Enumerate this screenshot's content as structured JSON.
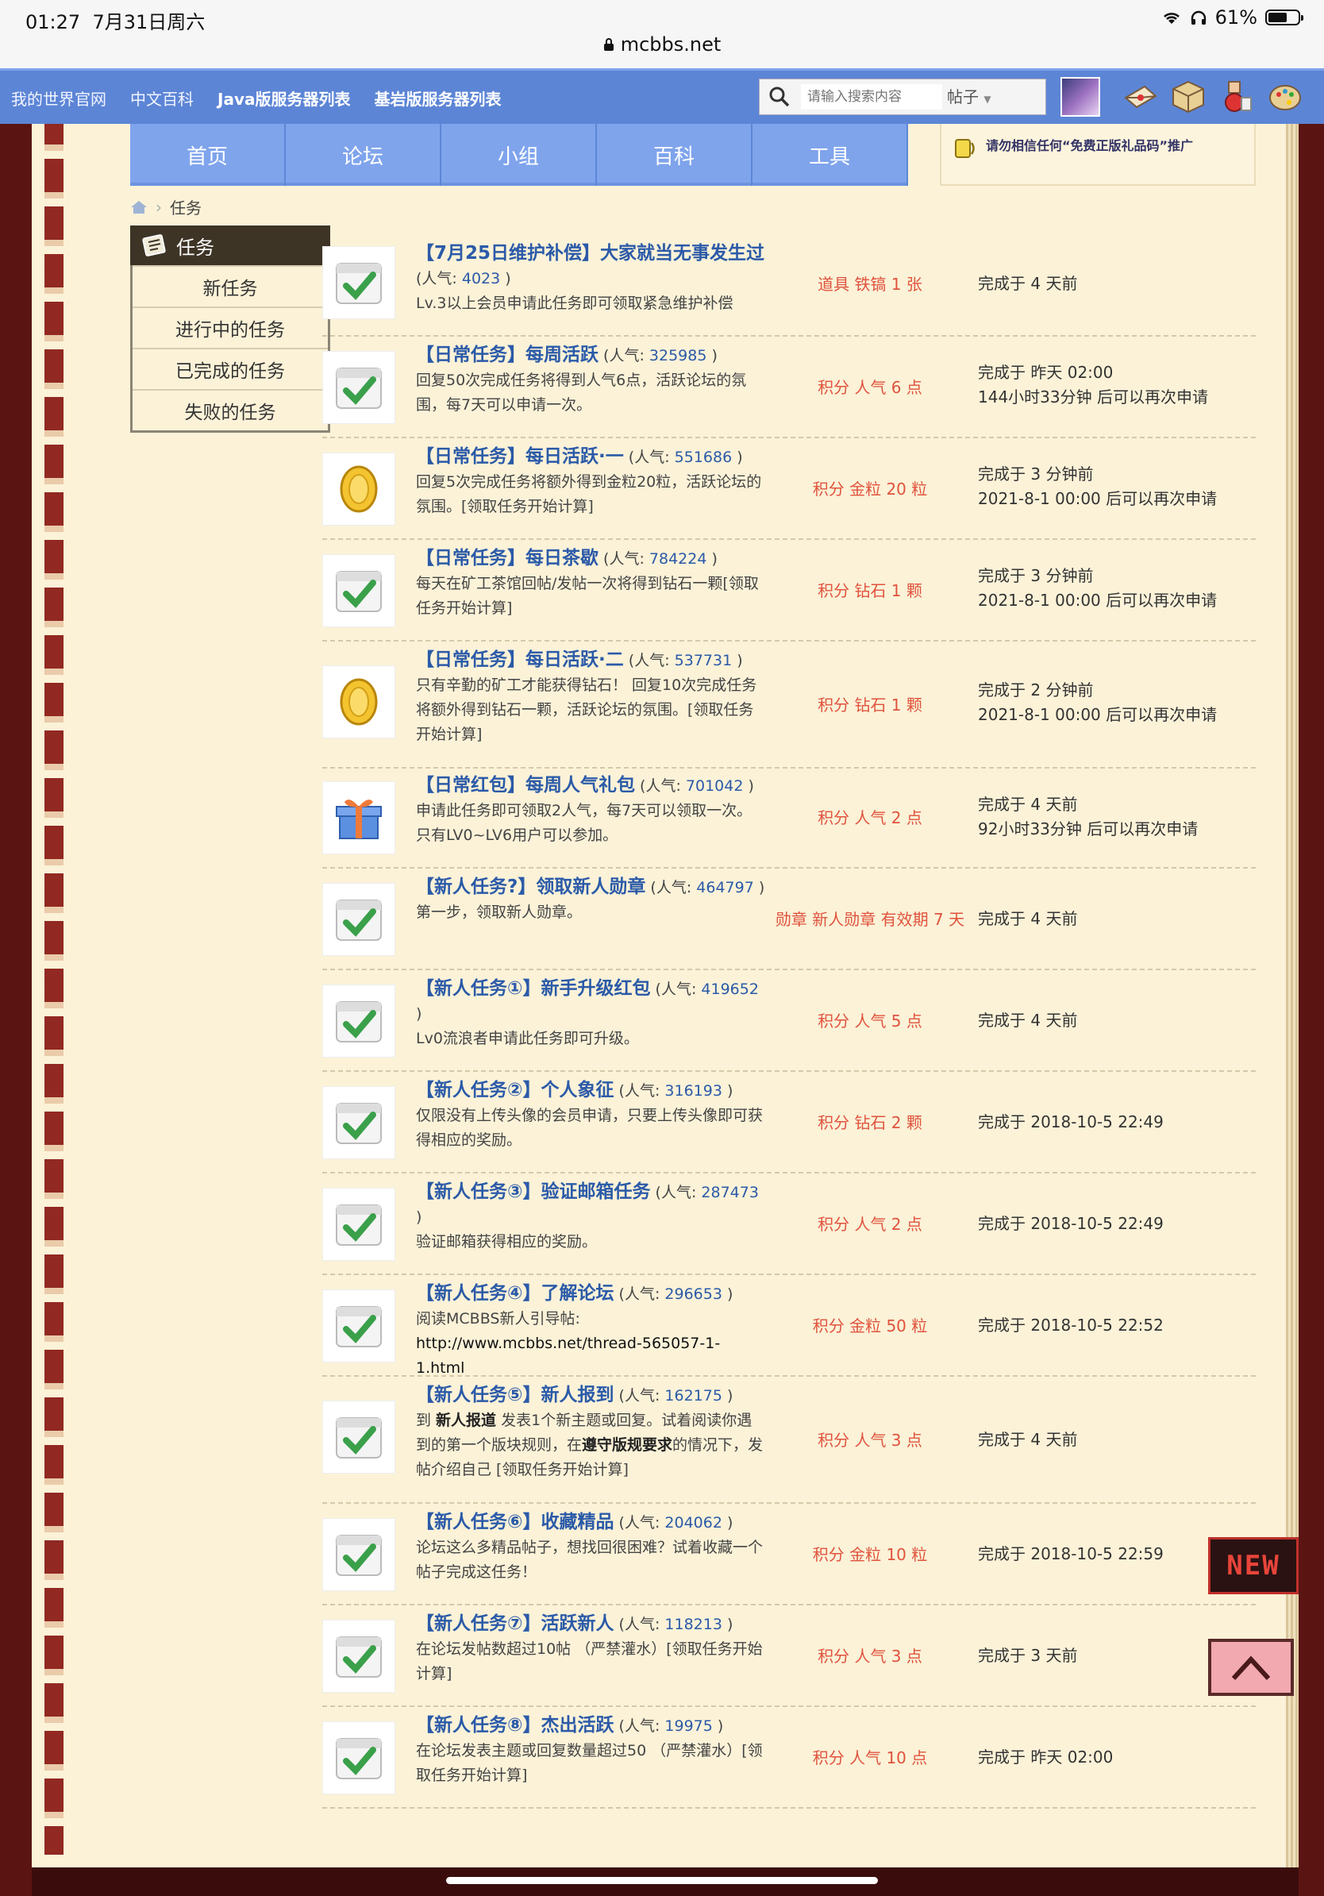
{
  "status_bar": {
    "time": "01:27",
    "date": "7月31日周六",
    "battery": "61%",
    "url": "mcbbs.net"
  },
  "top_links": [
    "我的世界官网",
    "中文百科",
    "Java版服务器列表",
    "基岩版服务器列表"
  ],
  "search": {
    "placeholder": "请输入搜索内容",
    "type": "帖子"
  },
  "main_nav": [
    "首页",
    "论坛",
    "小组",
    "百科",
    "工具"
  ],
  "notice": "请勿相信任何“免费正版礼品码”推广",
  "breadcrumb": {
    "current": "任务"
  },
  "sidebar": {
    "title": "任务",
    "items": [
      "新任务",
      "进行中的任务",
      "已完成的任务",
      "失败的任务"
    ]
  },
  "tasks": [
    {
      "icon": "check-calendar-icon",
      "title": "【7月25日维护补偿】大家就当无事发生过",
      "pop_label": "人气:",
      "popularity": "4023",
      "desc": "Lv.3以上会员申请此任务即可领取紧急维护补偿",
      "reward": "道具 铁镐 1 张",
      "status1": "完成于 4 天前",
      "status2": ""
    },
    {
      "icon": "check-calendar-icon",
      "title": "【日常任务】每周活跃",
      "pop_label": "人气:",
      "popularity": "325985",
      "desc": "回复50次完成任务将得到人气6点，活跃论坛的氛围，每7天可以申请一次。",
      "reward": "积分 人气 6 点",
      "status1": "完成于 昨天 02:00",
      "status2": "144小时33分钟 后可以再次申请"
    },
    {
      "icon": "gold-coin-icon",
      "title": "【日常任务】每日活跃·一",
      "pop_label": "人气:",
      "popularity": "551686",
      "desc": "回复5次完成任务将额外得到金粒20粒，活跃论坛的氛围。[领取任务开始计算]",
      "reward": "积分 金粒 20 粒",
      "status1": "完成于 3 分钟前",
      "status2": "2021-8-1 00:00 后可以再次申请"
    },
    {
      "icon": "check-calendar-icon",
      "title": "【日常任务】每日茶歇",
      "pop_label": "人气:",
      "popularity": "784224",
      "desc": "每天在矿工茶馆回帖/发帖一次将得到钻石一颗[领取任务开始计算]",
      "reward": "积分 钻石 1 颗",
      "status1": "完成于 3 分钟前",
      "status2": "2021-8-1 00:00 后可以再次申请"
    },
    {
      "icon": "gold-coin-icon",
      "title": "【日常任务】每日活跃·二",
      "pop_label": "人气:",
      "popularity": "537731",
      "desc": "只有辛勤的矿工才能获得钻石！ 回复10次完成任务将额外得到钻石一颗，活跃论坛的氛围。[领取任务开始计算]",
      "reward": "积分 钻石 1 颗",
      "status1": "完成于 2 分钟前",
      "status2": "2021-8-1 00:00 后可以再次申请"
    },
    {
      "icon": "gift-box-icon",
      "title": "【日常红包】每周人气礼包",
      "pop_label": "人气:",
      "popularity": "701042",
      "desc": "申请此任务即可领取2人气，每7天可以领取一次。 只有LV0~LV6用户可以参加。",
      "reward": "积分 人气 2 点",
      "status1": "完成于 4 天前",
      "status2": "92小时33分钟 后可以再次申请"
    },
    {
      "icon": "check-calendar-icon",
      "title": "【新人任务?】领取新人勋章",
      "pop_label": "人气:",
      "popularity": "464797",
      "desc": "第一步，领取新人勋章。",
      "reward": "勋章 新人勋章 有效期 7 天",
      "status1": "完成于 4 天前",
      "status2": ""
    },
    {
      "icon": "check-calendar-icon",
      "title": "【新人任务①】新手升级红包",
      "pop_label": "人气:",
      "popularity": "419652",
      "desc": "Lv0流浪者申请此任务即可升级。",
      "reward": "积分 人气 5 点",
      "status1": "完成于 4 天前",
      "status2": ""
    },
    {
      "icon": "check-calendar-icon",
      "title": "【新人任务②】个人象征",
      "pop_label": "人气:",
      "popularity": "316193",
      "desc": "仅限没有上传头像的会员申请，只要上传头像即可获得相应的奖励。",
      "reward": "积分 钻石 2 颗",
      "status1": "完成于 2018-10-5 22:49",
      "status2": ""
    },
    {
      "icon": "check-calendar-icon",
      "title": "【新人任务③】验证邮箱任务",
      "pop_label": "人气:",
      "popularity": "287473",
      "desc": "验证邮箱获得相应的奖励。",
      "reward": "积分 人气 2 点",
      "status1": "完成于 2018-10-5 22:49",
      "status2": ""
    },
    {
      "icon": "check-calendar-icon",
      "title": "【新人任务④】了解论坛",
      "pop_label": "人气:",
      "popularity": "296653",
      "desc": "阅读MCBBS新人引导帖:",
      "link": "http://www.mcbbs.net/thread-565057-1-1.html",
      "reward": "积分 金粒 50 粒",
      "status1": "完成于 2018-10-5 22:52",
      "status2": ""
    },
    {
      "icon": "check-calendar-icon",
      "title": "【新人任务⑤】新人报到",
      "pop_label": "人气:",
      "popularity": "162175",
      "desc_parts": [
        "到 ",
        "新人报道",
        " 发表1个新主题或回复。试着阅读你遇到的第一个版块规则，在",
        "遵守版规要求",
        "的情况下，发帖介绍自己 [领取任务开始计算]"
      ],
      "reward": "积分 人气 3 点",
      "status1": "完成于 4 天前",
      "status2": ""
    },
    {
      "icon": "check-calendar-icon",
      "title": "【新人任务⑥】收藏精品",
      "pop_label": "人气:",
      "popularity": "204062",
      "desc": "论坛这么多精品帖子，想找回很困难？试着收藏一个帖子完成这任务！",
      "reward": "积分 金粒 10 粒",
      "status1": "完成于 2018-10-5 22:59",
      "status2": ""
    },
    {
      "icon": "check-calendar-icon",
      "title": "【新人任务⑦】活跃新人",
      "pop_label": "人气:",
      "popularity": "118213",
      "desc": "在论坛发帖数超过10帖 （严禁灌水）[领取任务开始计算]",
      "reward": "积分 人气 3 点",
      "status1": "完成于 3 天前",
      "status2": ""
    },
    {
      "icon": "check-calendar-icon",
      "title": "【新人任务⑧】杰出活跃",
      "pop_label": "人气:",
      "popularity": "19975",
      "desc": "在论坛发表主题或回复数量超过50 （严禁灌水）[领取任务开始计算]",
      "reward": "积分 人气 10 点",
      "status1": "完成于 昨天 02:00",
      "status2": ""
    }
  ],
  "side_badges": {
    "new": "NEW",
    "message": "message-icon"
  },
  "colors": {
    "nav_blue": "#5c85d6",
    "tab_blue": "#7fa4ec",
    "title_blue": "#2b5aa8",
    "reward_red": "#e0533d",
    "page_bg": "#fbf2d8",
    "binding_red": "#5a1512"
  }
}
